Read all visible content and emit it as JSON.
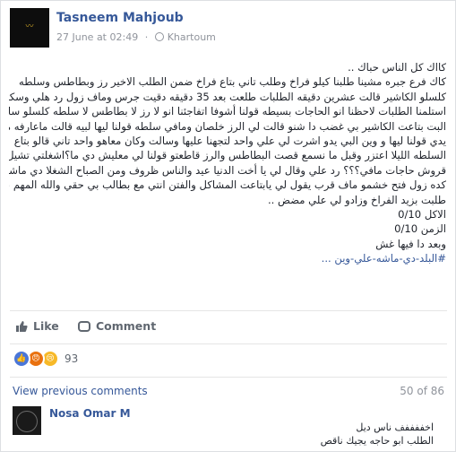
{
  "post": {
    "author": "Tasneem Mahjoub",
    "timestamp": "27 June at 02:49",
    "separator": "·",
    "location": "Khartoum",
    "lines": [
      "كااك كل الناس حباك ..",
      "كاك فرع جبره مشينا طلبنا كيلو فراخ وطلب تاني بتاع فراخ ضمن الطلب الاخير رز وبطاطس وسلطه",
      "كلسلو الكاشير قالت عشرين دقيقه الطلبات طلعت بعد 35 دقيقه دقيت جرس وماف زول رد هلي وسكتا",
      "استلمنا الطلبات لاحظنا انو الحاجات بسيطه قولنا أشوفا اتفاجئنا انو لا رز لا بطاطس لا سلطه كلسلو سالت",
      "البت بتاعت الكاشير بي غضب دا شنو قالت لي الرز خلصان ومافي سلطه قولنا ليها لبيه قالت ماعارفه مابي",
      "يدي قولنا ليها و وين البي يدو اشرت لي علي واحد لتجهنا عليها وسالت وكان معاهو واحد تاني قالو بتاع",
      "السلطه الليلا اعتزر وقبل ما نسمع قصت البطاطس والرز قاطعتو قولنا لي معليش دي ما؟اشغلتي تشيل من",
      "قروش حاجات مافي؟؟؟ رد علي وقال لي يا أخت الدنيا عيد والناس ظروف ومن الصباح الشغلا دي ماشه",
      "كده زول فتح خشمو ماف قرب يقول لي يابتاعت المشاكل والفتن انتي مع بطالب بي حقي والله المهم بعد شكل",
      "طلبت بزيد الفراخ وزادو لي علي مضض ..",
      "الاكل 0/10",
      "الزمن 0/10",
      "وبعد دا فيها غش",
      "#البلد-دي-ماشه-علي-وين ..."
    ]
  },
  "actions": {
    "like_label": "Like",
    "comment_label": "Comment"
  },
  "reactions": {
    "count": "93",
    "types": [
      "like",
      "angry",
      "sad"
    ]
  },
  "comments": {
    "view_previous": "View previous comments",
    "pagination": "50 of 86",
    "first": {
      "author": "Nosa Omar M",
      "lines": [
        "اخففففف ناس ديل",
        "الطلب ابو حاجه يجيك ناقص"
      ]
    }
  },
  "colors": {
    "link": "#365899",
    "muted": "#90949c",
    "like_blue": "#4a76d8",
    "angry_orange": "#e9710f",
    "sad_yellow": "#f7b928"
  }
}
